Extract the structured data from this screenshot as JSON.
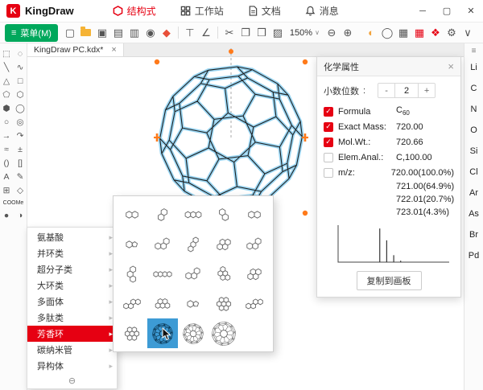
{
  "titlebar": {
    "app_name": "KingDraw",
    "logo_glyph": "K",
    "tabs": [
      {
        "id": "structure",
        "label": "结构式",
        "icon": "structure-icon",
        "active": true
      },
      {
        "id": "workspace",
        "label": "工作站",
        "icon": "workspace-icon",
        "active": false
      },
      {
        "id": "document",
        "label": "文档",
        "icon": "document-icon",
        "active": false
      },
      {
        "id": "message",
        "label": "消息",
        "icon": "notification-icon",
        "active": false
      }
    ],
    "window_controls": [
      {
        "name": "minimize-button",
        "glyph": "─"
      },
      {
        "name": "maximize-button",
        "glyph": "▢"
      },
      {
        "name": "close-button",
        "glyph": "✕"
      }
    ]
  },
  "menubar": {
    "menu_button_label": "菜单(M)",
    "menu_button_icon": "≡",
    "zoom_level": "150%",
    "zoom_caret": "∨",
    "zoom_out_glyph": "⊖",
    "zoom_in_glyph": "⊕",
    "left_icons": [
      {
        "name": "new-file-icon",
        "glyph": "▢"
      },
      {
        "name": "open-folder-icon",
        "glyph": "folder"
      },
      {
        "name": "save-icon",
        "glyph": "▣"
      },
      {
        "name": "save-as-icon",
        "glyph": "▤"
      },
      {
        "name": "print-icon",
        "glyph": "▥"
      },
      {
        "name": "stamp-icon",
        "glyph": "◉"
      },
      {
        "name": "eraser-icon",
        "glyph": "◆",
        "color": "#e8503a"
      },
      {
        "name": "separator"
      },
      {
        "name": "text-tool-icon",
        "glyph": "⊤"
      },
      {
        "name": "angle-tool-icon",
        "glyph": "∠"
      },
      {
        "name": "separator"
      },
      {
        "name": "cut-icon",
        "glyph": "✂"
      },
      {
        "name": "copy-icon",
        "glyph": "❐"
      },
      {
        "name": "paste-icon",
        "glyph": "❒"
      },
      {
        "name": "clean-icon",
        "glyph": "▨"
      }
    ],
    "right_icons": [
      {
        "name": "highlight-color-icon",
        "glyph": "◐",
        "color": "#f2a33c"
      },
      {
        "name": "fill-color-icon",
        "glyph": "◯"
      },
      {
        "name": "grid-view-icon",
        "glyph": "▦"
      },
      {
        "name": "template-panel-icon",
        "glyph": "▦",
        "color": "#e60012"
      },
      {
        "name": "share-icon",
        "glyph": "❖",
        "color": "#e60012"
      },
      {
        "name": "settings-icon",
        "glyph": "⚙"
      },
      {
        "name": "more-icon",
        "glyph": "∨"
      }
    ]
  },
  "doc_tab": {
    "label": "KingDraw PC.kdx*",
    "close_glyph": "×"
  },
  "left_tools": [
    {
      "name": "marquee-select-tool",
      "glyph": "⬚"
    },
    {
      "name": "lasso-select-tool",
      "glyph": "◌"
    },
    {
      "name": "bond-tool",
      "glyph": "╲"
    },
    {
      "name": "chain-tool",
      "glyph": "∿"
    },
    {
      "name": "cyclopropane-ring-tool",
      "glyph": "△"
    },
    {
      "name": "cyclobutane-ring-tool",
      "glyph": "□"
    },
    {
      "name": "cyclopentane-ring-tool",
      "glyph": "⬠"
    },
    {
      "name": "cyclohexane-ring-tool",
      "glyph": "⬡"
    },
    {
      "name": "benzene-ring-tool",
      "glyph": "⬢"
    },
    {
      "name": "cycloheptane-ring-tool",
      "glyph": "◯"
    },
    {
      "name": "cyclooctane-ring-tool",
      "glyph": "○"
    },
    {
      "name": "variable-ring-tool",
      "glyph": "◎"
    },
    {
      "name": "arrow-tool",
      "glyph": "→"
    },
    {
      "name": "curved-arrow-tool",
      "glyph": "↷"
    },
    {
      "name": "wavy-bond-tool",
      "glyph": "≈"
    },
    {
      "name": "charge-tool",
      "glyph": "±"
    },
    {
      "name": "paren-bracket-tool",
      "glyph": "()"
    },
    {
      "name": "square-bracket-tool",
      "glyph": "[]"
    },
    {
      "name": "text-tool",
      "glyph": "A"
    },
    {
      "name": "pencil-tool",
      "glyph": "✎"
    },
    {
      "name": "template-tool",
      "glyph": "⊞"
    },
    {
      "name": "symbol-tool",
      "glyph": "◇"
    },
    {
      "name": "abbreviation-tool",
      "glyph": "COOMe",
      "wide": true
    },
    {
      "name": "orbital-filled-tool",
      "glyph": "●"
    },
    {
      "name": "orbital-half-tool",
      "glyph": "◑"
    }
  ],
  "elements_strip": {
    "toggle_icon": "≡",
    "elements": [
      "Li",
      "C",
      "N",
      "O",
      "Si",
      "Cl",
      "Ar",
      "As",
      "Br",
      "Pd"
    ]
  },
  "properties_panel": {
    "title": "化学属性",
    "close_glyph": "×",
    "decimal": {
      "label": "小数位数",
      "colon": ":",
      "minus": "-",
      "value": "2",
      "plus": "+"
    },
    "rows": [
      {
        "name": "formula",
        "label": "Formula",
        "checked": true,
        "value": "C",
        "sub": "60"
      },
      {
        "name": "exact-mass",
        "label": "Exact Mass:",
        "checked": true,
        "value": "720.00"
      },
      {
        "name": "mol-wt",
        "label": "Mol.Wt.:",
        "checked": true,
        "value": "720.66"
      },
      {
        "name": "elem-anal",
        "label": "Elem.Anal.:",
        "checked": false,
        "value": "C,100.00"
      },
      {
        "name": "mz",
        "label": "m/z:",
        "checked": false,
        "value": "720.00(100.0%)"
      }
    ],
    "mz_extra": [
      "721.00(64.9%)",
      "722.01(20.7%)",
      "723.01(4.3%)"
    ],
    "copy_button": "复制到画板"
  },
  "chart_data": {
    "type": "bar",
    "title": "",
    "x": [
      720.0,
      721.0,
      722.01,
      723.01
    ],
    "values": [
      100.0,
      64.9,
      20.7,
      4.3
    ],
    "xlabel": "",
    "ylabel": "",
    "xlim": [
      714,
      730
    ],
    "ylim": [
      0,
      110
    ],
    "grid": false,
    "legend": false
  },
  "context_menu": {
    "items": [
      {
        "label": "氨基酸"
      },
      {
        "label": "并环类"
      },
      {
        "label": "超分子类"
      },
      {
        "label": "大环类"
      },
      {
        "label": "多面体"
      },
      {
        "label": "多肽类"
      },
      {
        "label": "芳香环",
        "highlighted": true
      },
      {
        "label": "碳纳米管"
      },
      {
        "label": "异构体"
      }
    ],
    "scroll_icon": "⊖",
    "arrow_glyph": "▸"
  },
  "template_grid": {
    "cells": [
      {
        "name": "aromatic-template-1",
        "type": "h2"
      },
      {
        "name": "aromatic-template-2",
        "type": "h2d"
      },
      {
        "name": "aromatic-template-3",
        "type": "h3"
      },
      {
        "name": "aromatic-template-4",
        "type": "h2v"
      },
      {
        "name": "aromatic-template-5",
        "type": "h2"
      },
      {
        "name": "aromatic-template-6",
        "type": "hp"
      },
      {
        "name": "aromatic-template-7",
        "type": "h3a"
      },
      {
        "name": "aromatic-template-8",
        "type": "h3d"
      },
      {
        "name": "aromatic-template-9",
        "type": "h4"
      },
      {
        "name": "aromatic-template-10",
        "type": "h3a"
      },
      {
        "name": "aromatic-template-11",
        "type": "h3v"
      },
      {
        "name": "aromatic-template-12",
        "type": "h4l"
      },
      {
        "name": "aromatic-template-13",
        "type": "h3a"
      },
      {
        "name": "aromatic-template-14",
        "type": "h5c"
      },
      {
        "name": "aromatic-template-15",
        "type": "h4"
      },
      {
        "name": "aromatic-template-16",
        "type": "h4z"
      },
      {
        "name": "aromatic-template-17",
        "type": "h5"
      },
      {
        "name": "aromatic-template-18",
        "type": "hp"
      },
      {
        "name": "aromatic-template-19",
        "type": "cor"
      },
      {
        "name": "aromatic-template-20",
        "type": "h4z"
      },
      {
        "name": "aromatic-template-21",
        "type": "cor"
      },
      {
        "name": "fullerene-template-selected",
        "type": "ball",
        "selected": true
      },
      {
        "name": "fullerene-template-c60",
        "type": "ball"
      },
      {
        "name": "fullerene-template-c70",
        "type": "ball-large"
      },
      {
        "name": "aromatic-template-empty",
        "type": "empty"
      }
    ]
  },
  "molecule": {
    "name": "C60 fullerene",
    "selected": true,
    "highlight_color": "#53b8e8",
    "bond_color": "#1c1c1c",
    "handle_color": "#ff7a1a"
  }
}
